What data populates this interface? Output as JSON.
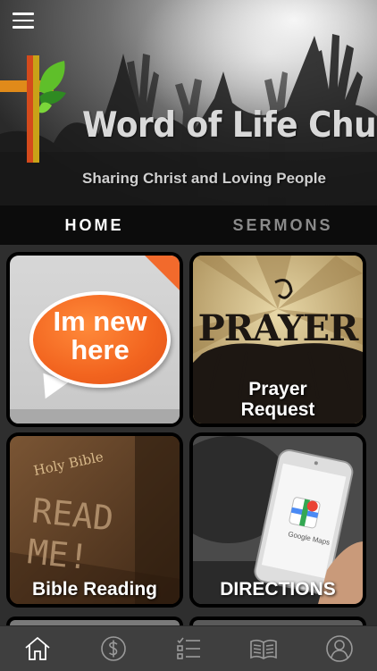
{
  "header": {
    "title": "Word of Life Church",
    "subtitle": "Sharing Christ and Loving People",
    "menu_icon": "hamburger-menu-icon",
    "logo": "cross-with-leaves-logo"
  },
  "tabs": [
    {
      "label": "HOME",
      "active": true
    },
    {
      "label": "SERMONS",
      "active": false
    }
  ],
  "tiles": [
    {
      "label": "",
      "image_text": "Im new here",
      "bg": "#c8c8c8",
      "accent": "#f2641f"
    },
    {
      "label": "Prayer Request",
      "image_text": "PRAYER",
      "bg": "#bfa572"
    },
    {
      "label": "Bible Reading",
      "image_text": "READ ME!",
      "cover_text": "Holy Bible",
      "bg": "#5a3b24"
    },
    {
      "label": "DIRECTIONS",
      "image_text": "Google Maps",
      "bg": "#3a3a3a"
    }
  ],
  "bottom_nav": [
    {
      "icon": "home-icon",
      "active": true
    },
    {
      "icon": "dollar-icon",
      "active": false
    },
    {
      "icon": "checklist-icon",
      "active": false
    },
    {
      "icon": "book-icon",
      "active": false
    },
    {
      "icon": "profile-icon",
      "active": false
    }
  ],
  "colors": {
    "tab_bar": "#0c0c0c",
    "active_tab": "#ffffff",
    "inactive_tab": "#8a8a8a",
    "bottom_bar": "#3f3f3f",
    "accent_orange": "#f2641f"
  }
}
